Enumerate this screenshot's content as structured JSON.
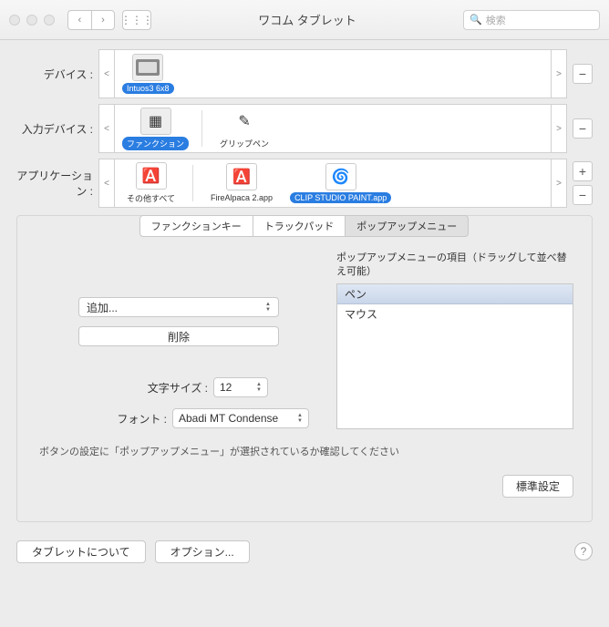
{
  "window": {
    "title": "ワコム タブレット",
    "search_placeholder": "検索"
  },
  "rows": {
    "device_label": "デバイス :",
    "input_label": "入力デバイス :",
    "app_label": "アプリケーション :",
    "device_items": [
      {
        "label": "Intuos3 6x8",
        "selected": true
      }
    ],
    "input_items": [
      {
        "label": "ファンクション",
        "selected": true
      },
      {
        "label": "グリップペン",
        "selected": false
      }
    ],
    "app_items": [
      {
        "label": "その他すべて",
        "selected": false
      },
      {
        "label": "FireAlpaca 2.app",
        "selected": false
      },
      {
        "label": "CLIP STUDIO PAINT.app",
        "selected": true
      }
    ]
  },
  "tabs": [
    {
      "label": "ファンクションキー",
      "active": false
    },
    {
      "label": "トラックパッド",
      "active": false
    },
    {
      "label": "ポップアップメニュー",
      "active": true
    }
  ],
  "popup": {
    "add_label": "追加...",
    "delete_label": "削除",
    "fontsize_label": "文字サイズ :",
    "fontsize_value": "12",
    "font_label": "フォント :",
    "font_value": "Abadi MT Condense",
    "list_title": "ポップアップメニューの項目（ドラッグして並べ替え可能）",
    "list_header": "ペン",
    "list_items": [
      "マウス"
    ],
    "hint": "ボタンの設定に「ポップアップメニュー」が選択されているか確認してください",
    "default_button": "標準設定"
  },
  "bottom": {
    "about": "タブレットについて",
    "options": "オプション..."
  }
}
